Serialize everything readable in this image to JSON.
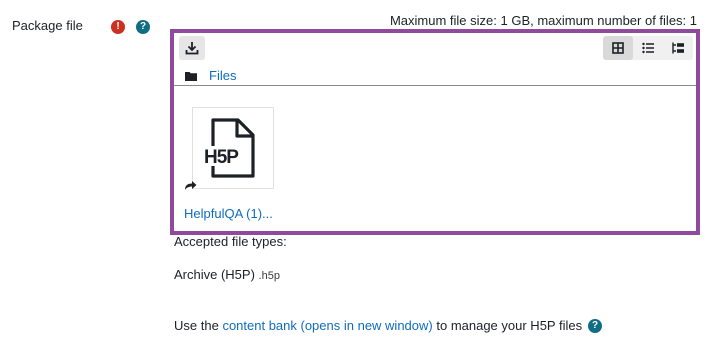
{
  "field": {
    "label": "Package file",
    "required_glyph": "!",
    "help_glyph": "?",
    "max_size_text": "Maximum file size: 1 GB, maximum number of files: 1"
  },
  "filemanager": {
    "icons": {
      "download": "download-icon",
      "thumbnails": "grid-icon",
      "list": "list-icon",
      "tree": "tree-icon",
      "folder": "folder-icon",
      "alias": "alias-arrow-icon",
      "file": "h5p-file-icon"
    },
    "path_label": "Files",
    "file": {
      "thumb_text": "H5P",
      "name": "HelpfulQA (1)..."
    }
  },
  "accepted": {
    "title": "Accepted file types:",
    "type_name": "Archive (H5P)",
    "extension": ".h5p"
  },
  "content_bank": {
    "prefix": "Use the",
    "link": "content bank (opens in new window)",
    "suffix": "to manage your H5P files",
    "help_glyph": "?"
  },
  "colors": {
    "accent_border": "#8f4a9e",
    "link": "#0f6cbf",
    "required": "#ca3120",
    "help": "#0f6e84"
  }
}
